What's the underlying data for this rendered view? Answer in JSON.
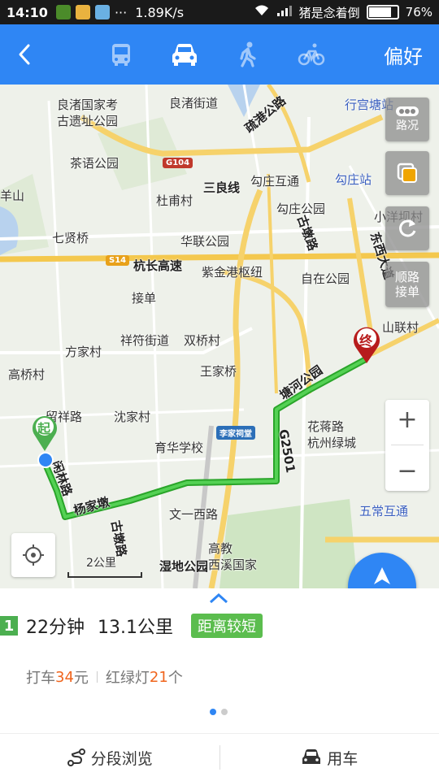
{
  "status_bar": {
    "time": "14:10",
    "network_speed": "1.89K/s",
    "carrier": "猪是念着倒",
    "battery": "76%",
    "battery_level": 0.76
  },
  "top_bar": {
    "back_icon": "chevron-left-icon",
    "modes": [
      {
        "name": "bus",
        "icon": "bus-icon",
        "active": false
      },
      {
        "name": "car",
        "icon": "car-icon",
        "active": true
      },
      {
        "name": "walk",
        "icon": "walk-icon",
        "active": false
      },
      {
        "name": "bike",
        "icon": "bike-icon",
        "active": false
      }
    ],
    "preference_label": "偏好"
  },
  "map": {
    "place_labels": [
      "良渚国家考",
      "古遗址公园",
      "良渚街道",
      "疏港公路",
      "行宫塘站",
      "路况",
      "茶语公园",
      "G104",
      "三良线",
      "勾庄互通",
      "勾庄站",
      "羊山",
      "杜甫村",
      "勾庄公园",
      "古墩路",
      "小洋坝村",
      "七贤桥",
      "华联公园",
      "S14",
      "杭长高速",
      "紫金港枢纽",
      "自在公园",
      "东西大道",
      "顺路",
      "接单",
      "山联村",
      "祥符街道",
      "双桥村",
      "方家村",
      "高桥村",
      "王家桥",
      "塘河公园",
      "留祥路",
      "沈家村",
      "李家祠堂",
      "G2501",
      "花蒋路",
      "杭州绿城",
      "育华学校",
      "杨家墩",
      "文一西路",
      "五常互通",
      "古墩路",
      "高教",
      "西溪国家",
      "湿地公园",
      "荆长",
      "路",
      "2公里",
      "起",
      "终",
      "闲林路"
    ],
    "traffic_button": "路况",
    "layers_icon": "layers-icon",
    "refresh_icon": "refresh-icon",
    "shunlu_button": "顺路\n接单",
    "zoom_in": "+",
    "zoom_out": "−",
    "locate_icon": "locate-icon",
    "scale": "2公里",
    "start_marker": "起",
    "end_marker": "终",
    "nav_button": "导航"
  },
  "route": {
    "index": "1",
    "time": "22分钟",
    "distance": "13.1公里",
    "tag": "距离较短",
    "taxi_prefix": "打车",
    "taxi_cost": "34",
    "taxi_unit": "元",
    "lights_prefix": "红绿灯",
    "lights_count": "21",
    "lights_unit": "个"
  },
  "actions": {
    "segment_browse": "分段浏览",
    "use_car": "用车"
  },
  "colors": {
    "primary": "#2f86f4",
    "route": "#3ab53a",
    "highlight": "#f0651d",
    "tag": "#5bbd4e"
  }
}
